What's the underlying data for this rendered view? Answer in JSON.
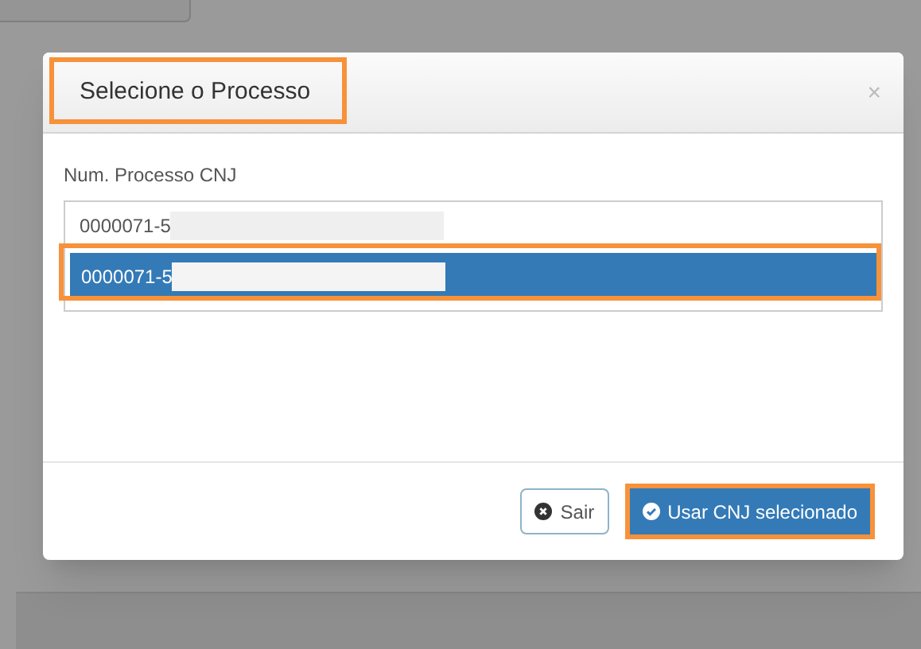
{
  "dialog": {
    "title": "Selecione o Processo",
    "close": "×",
    "field_label": "Num. Processo CNJ",
    "options": [
      {
        "text": "0000071-5",
        "selected": false
      },
      {
        "text": "0000071-5",
        "selected": true
      }
    ],
    "buttons": [
      {
        "label": "Sair",
        "kind": "default"
      },
      {
        "label": "Usar CNJ selecionado",
        "kind": "primary"
      }
    ]
  }
}
